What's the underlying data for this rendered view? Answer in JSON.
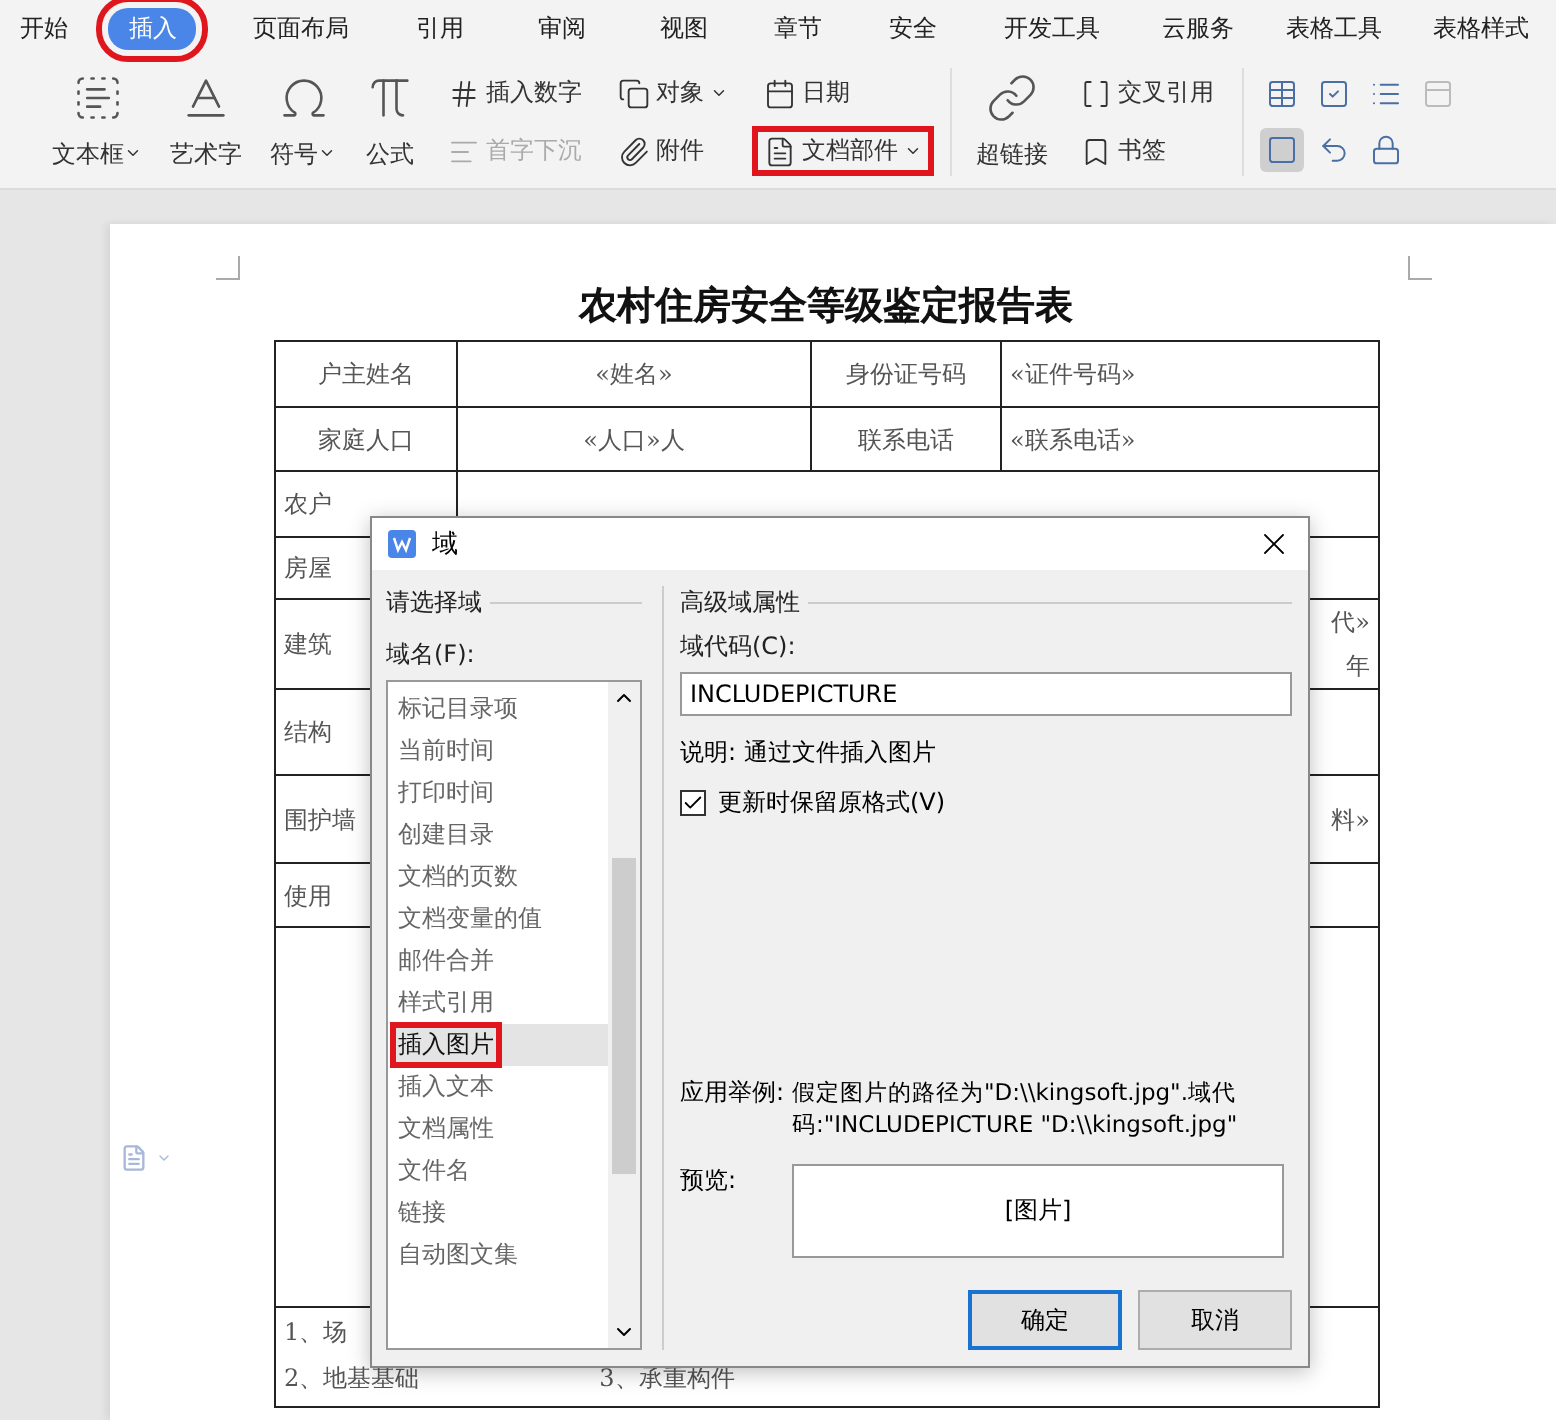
{
  "menu_tabs": [
    {
      "label": "开始",
      "selected": false,
      "highlighted": false
    },
    {
      "label": "插入",
      "selected": true,
      "highlighted": true
    },
    {
      "label": "页面布局",
      "selected": false,
      "highlighted": false
    },
    {
      "label": "引用",
      "selected": false,
      "highlighted": false
    },
    {
      "label": "审阅",
      "selected": false,
      "highlighted": false
    },
    {
      "label": "视图",
      "selected": false,
      "highlighted": false
    },
    {
      "label": "章节",
      "selected": false,
      "highlighted": false
    },
    {
      "label": "安全",
      "selected": false,
      "highlighted": false
    },
    {
      "label": "开发工具",
      "selected": false,
      "highlighted": false
    },
    {
      "label": "云服务",
      "selected": false,
      "highlighted": false
    },
    {
      "label": "表格工具",
      "selected": false,
      "highlighted": false
    },
    {
      "label": "表格样式",
      "selected": false,
      "highlighted": false
    }
  ],
  "ribbon": {
    "large_tools": [
      {
        "label": "文本框",
        "dropdown": true
      },
      {
        "label": "艺术字",
        "dropdown": false
      },
      {
        "label": "符号",
        "dropdown": true
      },
      {
        "label": "公式",
        "dropdown": false
      }
    ],
    "small_columns": [
      [
        {
          "label": "插入数字",
          "dropdown": false,
          "disabled": false,
          "highlighted": false
        },
        {
          "label": "首字下沉",
          "dropdown": false,
          "disabled": true,
          "highlighted": false
        }
      ],
      [
        {
          "label": "对象",
          "dropdown": true,
          "disabled": false,
          "highlighted": false
        },
        {
          "label": "附件",
          "dropdown": false,
          "disabled": false,
          "highlighted": false
        }
      ],
      [
        {
          "label": "日期",
          "dropdown": false,
          "disabled": false,
          "highlighted": false
        },
        {
          "label": "文档部件",
          "dropdown": true,
          "disabled": false,
          "highlighted": true
        }
      ]
    ],
    "link_tool": {
      "label": "超链接"
    },
    "link_column": [
      {
        "label": "交叉引用",
        "dropdown": false,
        "disabled": false,
        "highlighted": false
      },
      {
        "label": "书签",
        "dropdown": false,
        "disabled": false,
        "highlighted": false
      }
    ],
    "table_icons": [
      {
        "active": false,
        "disabled": false
      },
      {
        "active": false,
        "disabled": false
      },
      {
        "active": false,
        "disabled": false
      },
      {
        "active": false,
        "disabled": true
      },
      {
        "active": true,
        "disabled": false
      },
      {
        "active": false,
        "disabled": false
      },
      {
        "active": false,
        "disabled": false
      }
    ]
  },
  "document": {
    "title": "农村住房安全等级鉴定报告表",
    "rows": [
      {
        "cells": [
          {
            "text": "户主姓名"
          },
          {
            "text": "«姓名»"
          },
          {
            "text": "身份证号码"
          },
          {
            "text": "«证件号码»"
          }
        ]
      },
      {
        "cells": [
          {
            "text": "家庭人口"
          },
          {
            "text": "«人口»人"
          },
          {
            "text": "联系电话"
          },
          {
            "text": "«联系电话»"
          }
        ]
      },
      {
        "cells": [
          {
            "text": "农户"
          }
        ]
      },
      {
        "cells": [
          {
            "text": "房屋",
            "colspan": 4
          }
        ]
      },
      {
        "cells": [
          {
            "text": "建筑",
            "colspan": 3
          },
          {
            "text": "代»\n年"
          }
        ]
      },
      {
        "cells": [
          {
            "text": "结构",
            "colspan": 4
          }
        ]
      },
      {
        "cells": [
          {
            "text": "围护墙",
            "colspan": 3
          },
          {
            "text": "料»"
          }
        ]
      },
      {
        "cells": [
          {
            "text": "使用",
            "colspan": 4
          }
        ]
      }
    ],
    "notes": [
      "1、场",
      "2、地基基础",
      "3、承重构件"
    ]
  },
  "dialog": {
    "title": "域",
    "left_heading": "请选择域",
    "list_label": "域名(F):",
    "fields": [
      {
        "label": "标记目录项",
        "selected": false,
        "highlighted": false
      },
      {
        "label": "当前时间",
        "selected": false,
        "highlighted": false
      },
      {
        "label": "打印时间",
        "selected": false,
        "highlighted": false
      },
      {
        "label": "创建目录",
        "selected": false,
        "highlighted": false
      },
      {
        "label": "文档的页数",
        "selected": false,
        "highlighted": false
      },
      {
        "label": "文档变量的值",
        "selected": false,
        "highlighted": false
      },
      {
        "label": "邮件合并",
        "selected": false,
        "highlighted": false
      },
      {
        "label": "样式引用",
        "selected": false,
        "highlighted": false
      },
      {
        "label": "插入图片",
        "selected": true,
        "highlighted": true
      },
      {
        "label": "插入文本",
        "selected": false,
        "highlighted": false
      },
      {
        "label": "文档属性",
        "selected": false,
        "highlighted": false
      },
      {
        "label": "文件名",
        "selected": false,
        "highlighted": false
      },
      {
        "label": "链接",
        "selected": false,
        "highlighted": false
      },
      {
        "label": "自动图文集",
        "selected": false,
        "highlighted": false
      }
    ],
    "right_heading": "高级域属性",
    "code_label": "域代码(C):",
    "code_value": "INCLUDEPICTURE",
    "description": "说明: 通过文件插入图片",
    "keep_format": {
      "label": "更新时保留原格式(V)",
      "checked": true
    },
    "example_label": "应用举例:",
    "example_text": "假定图片的路径为\"D:\\\\kingsoft.jpg\".域代码:\"INCLUDEPICTURE \"D:\\\\kingsoft.jpg\"",
    "preview_label": "预览:",
    "preview_text": "[图片]",
    "ok": "确定",
    "cancel": "取消"
  }
}
